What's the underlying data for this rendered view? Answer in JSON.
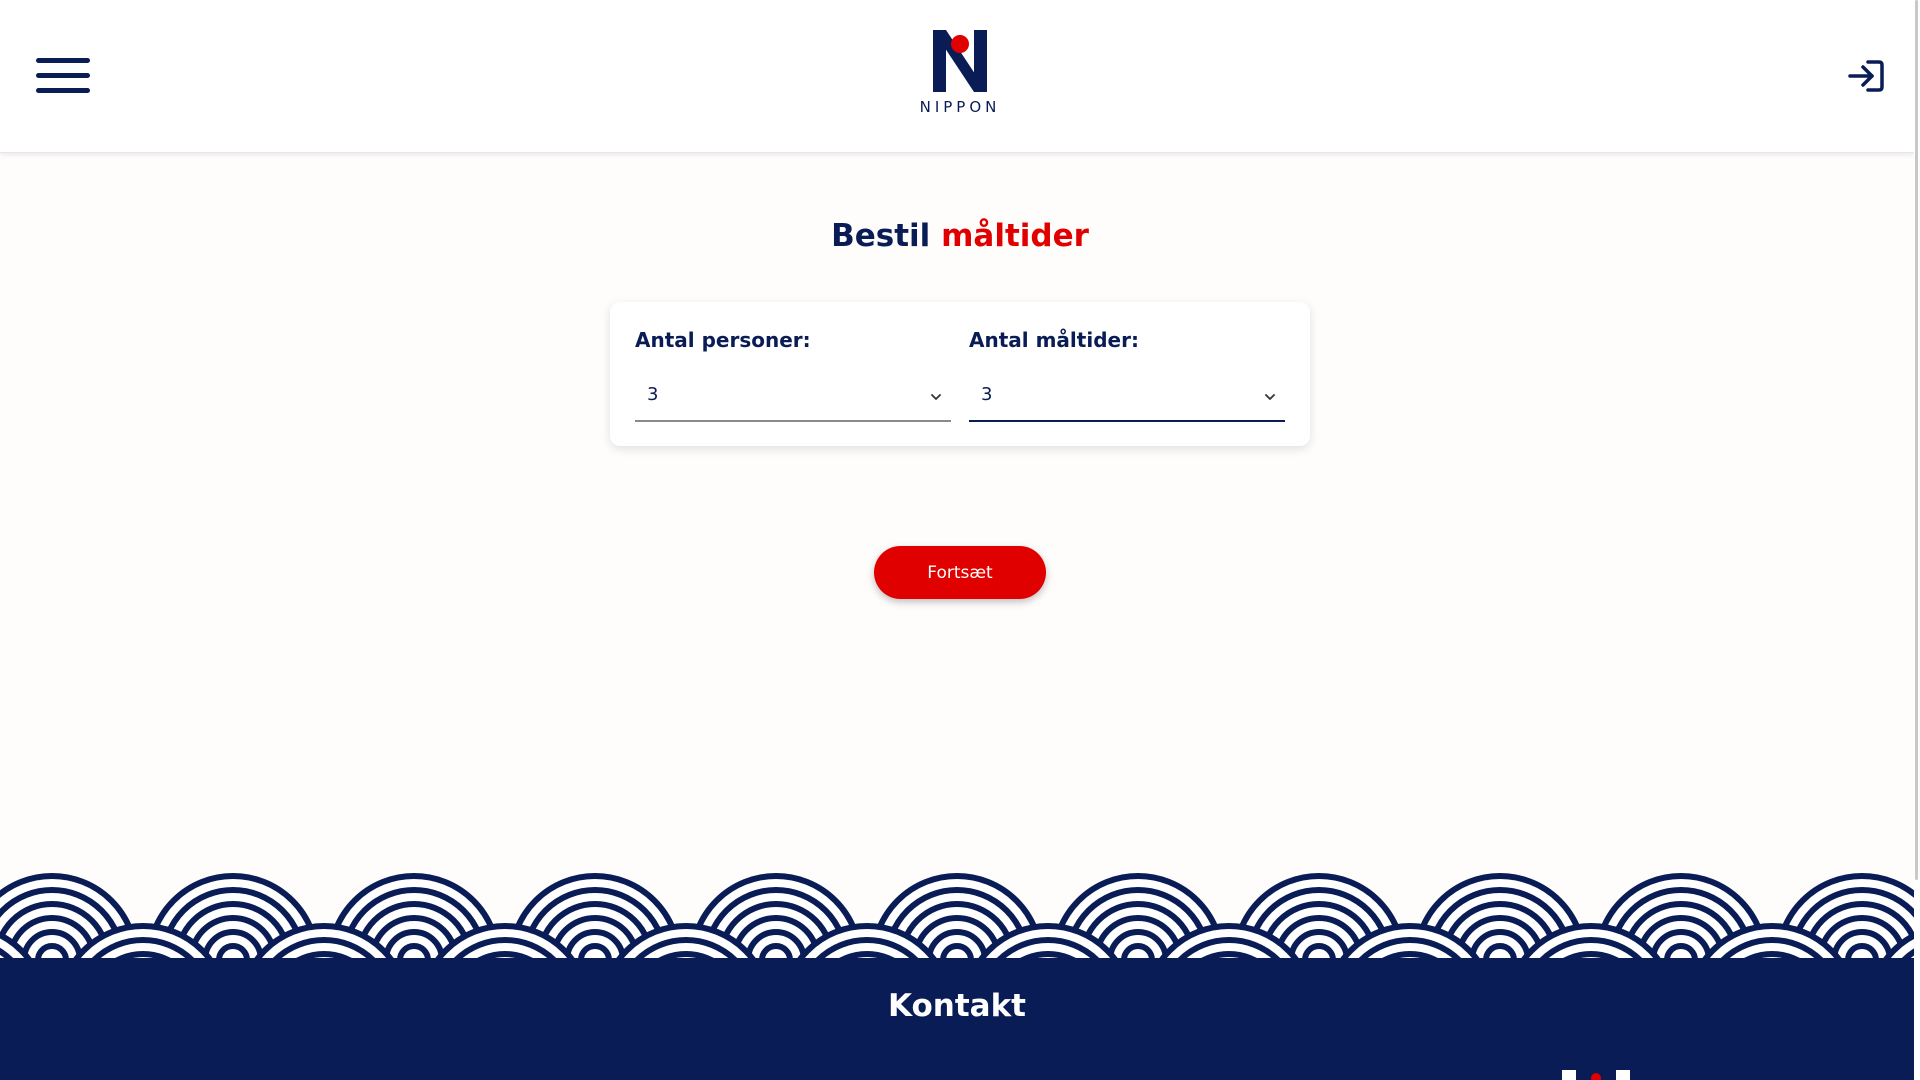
{
  "header": {
    "menu_icon": "hamburger-menu-icon",
    "logo_text": "NIPPON",
    "login_icon": "sign-in-icon"
  },
  "main": {
    "title_part1": "Bestil",
    "title_part2": "måltider",
    "persons": {
      "label": "Antal personer:",
      "value": "3"
    },
    "meals": {
      "label": "Antal måltider:",
      "value": "3"
    },
    "continue_label": "Fortsæt"
  },
  "footer": {
    "title": "Kontakt"
  },
  "colors": {
    "navy": "#091c56",
    "red": "#e00000",
    "white": "#ffffff"
  }
}
